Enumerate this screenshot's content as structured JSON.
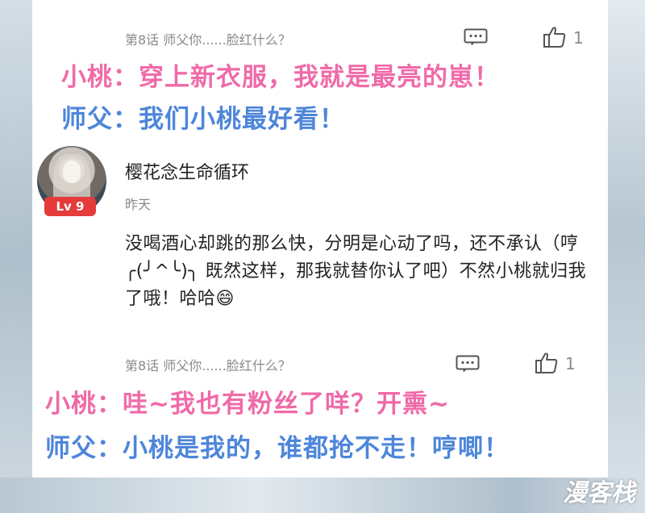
{
  "comment1": {
    "chapter": "第8话 师父你......脸红什么？",
    "like_count": "1",
    "comment_icon": "comment-icon",
    "like_icon": "thumbs-up-icon"
  },
  "caption1": {
    "line_pink": "小桃：穿上新衣服，我就是最亮的崽！",
    "line_blue": "师父：我们小桃最好看！"
  },
  "comment2": {
    "username": "樱花念生命循环",
    "level": "Lv 9",
    "time": "昨天",
    "text": "没喝酒心却跳的那么快，分明是心动了吗，还不承认（哼 ╭(╯^╰)╮ 既然这样，那我就替你认了吧）不然小桃就归我了哦！哈哈😄",
    "chapter": "第8话 师父你......脸红什么？",
    "like_count": "1"
  },
  "caption2": {
    "line_pink": "小桃：哇~我也有粉丝了咩？开熏~",
    "line_blue": "师父：小桃是我的，谁都抢不走！哼唧！"
  },
  "watermark": "漫客栈",
  "colors": {
    "pink": "#f06aa8",
    "blue": "#4d86da",
    "badge_red": "#e53b3b"
  }
}
